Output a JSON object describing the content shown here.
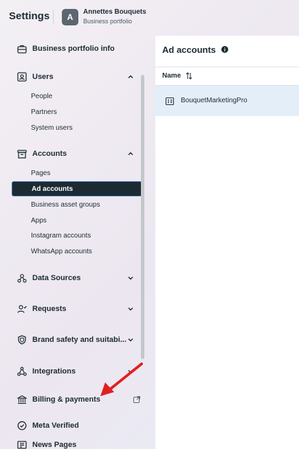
{
  "header": {
    "app_title": "Settings",
    "avatar_letter": "A",
    "account_name": "Annettes Bouquets",
    "account_subtitle": "Business portfolio"
  },
  "sidebar": {
    "business_portfolio_info": "Business portfolio info",
    "users": {
      "label": "Users",
      "items": [
        "People",
        "Partners",
        "System users"
      ]
    },
    "accounts": {
      "label": "Accounts",
      "items": [
        "Pages",
        "Ad accounts",
        "Business asset groups",
        "Apps",
        "Instagram accounts",
        "WhatsApp accounts"
      ],
      "active": "Ad accounts"
    },
    "data_sources": "Data Sources",
    "requests": "Requests",
    "brand_safety": "Brand safety and suitabi...",
    "integrations": "Integrations",
    "billing": "Billing & payments",
    "meta_verified": "Meta Verified",
    "news_pages": "News Pages"
  },
  "main": {
    "title": "Ad accounts",
    "column_name": "Name",
    "rows": [
      "BouquetMarketingPro"
    ]
  },
  "colors": {
    "text": "#1c2b33",
    "active_bg": "#1c2b33",
    "selected_row": "#e3eef9",
    "annotation_arrow": "#e02020"
  }
}
